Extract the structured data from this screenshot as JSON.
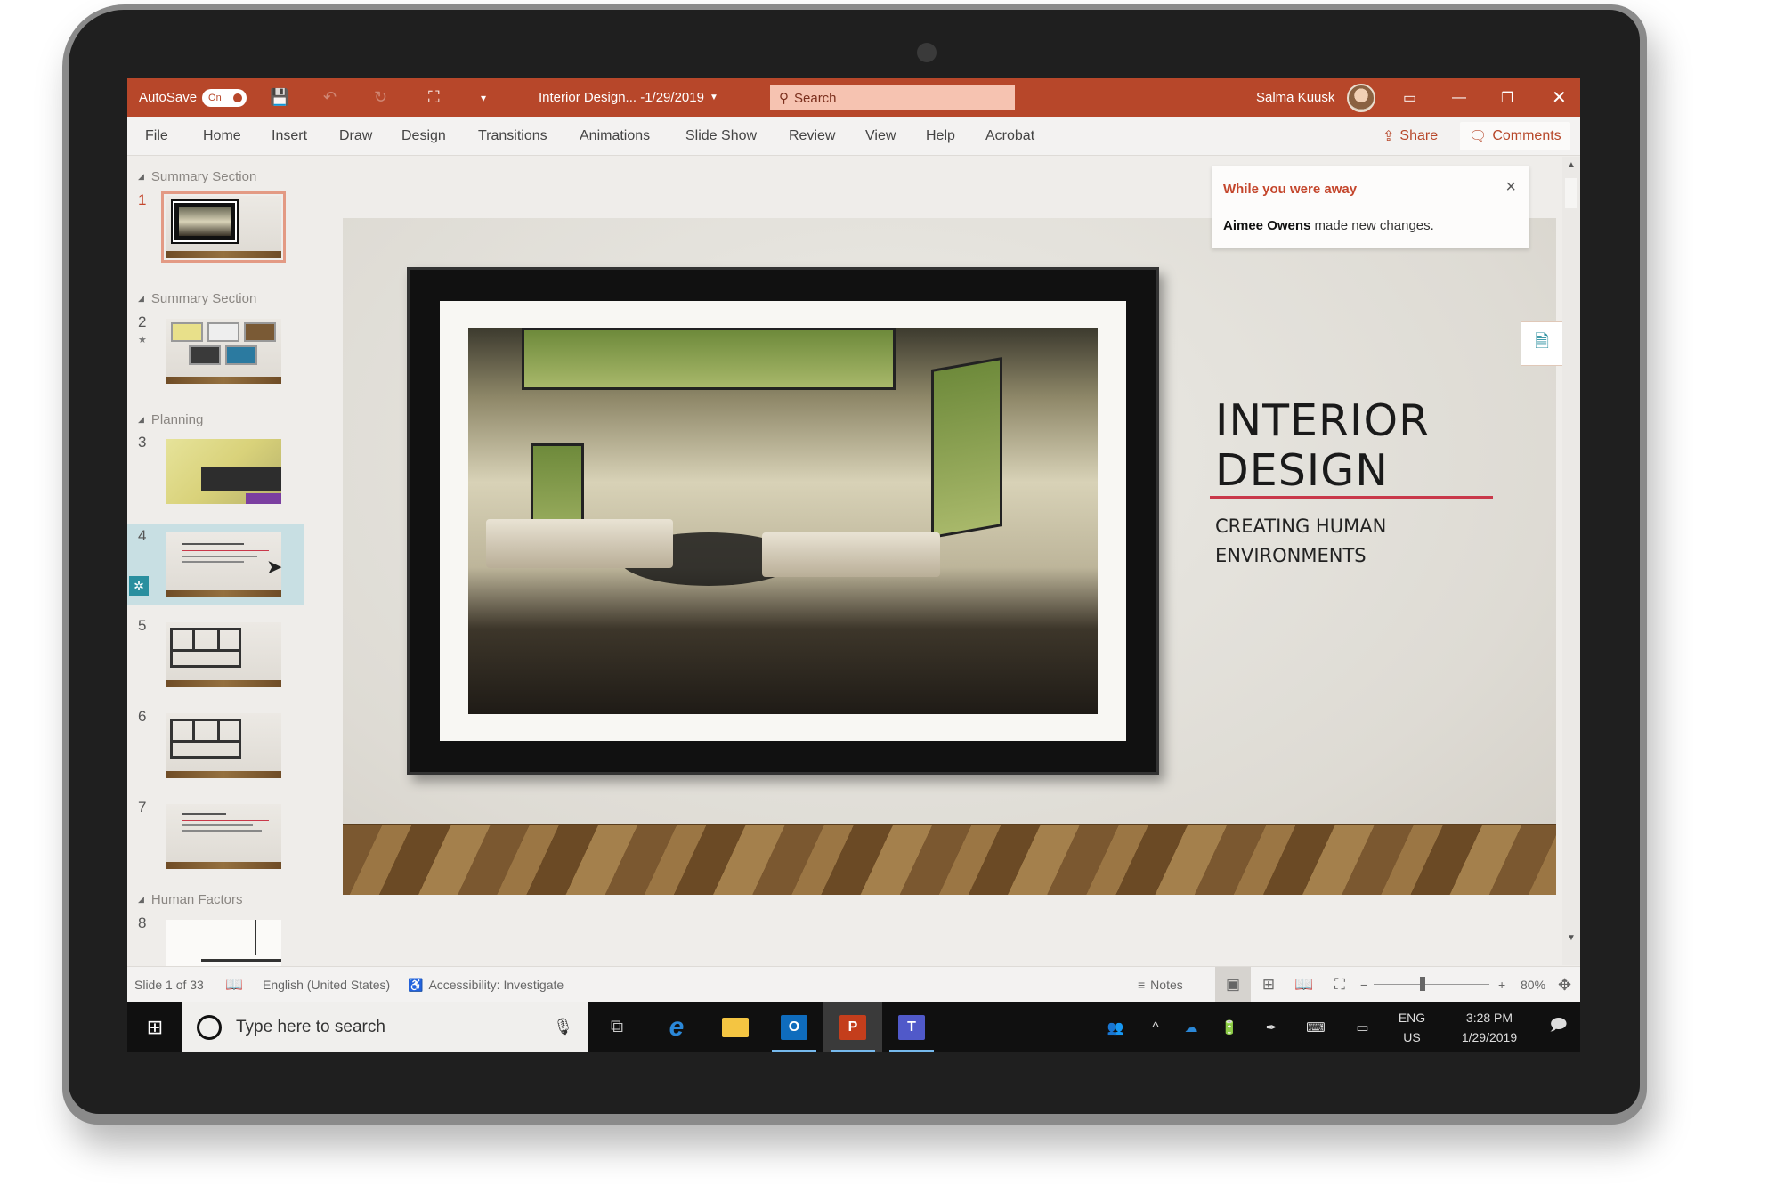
{
  "titlebar": {
    "autosave_label": "AutoSave",
    "autosave_state": "On",
    "doc_title": "Interior Design... -1/29/2019",
    "search_placeholder": "Search",
    "user_name": "Salma Kuusk",
    "icons": [
      "save-icon",
      "undo-icon",
      "redo-icon",
      "start-from-beginning-icon",
      "customize-qat-icon"
    ],
    "window_controls": [
      "ribbon-display-options",
      "minimize",
      "restore",
      "close"
    ]
  },
  "ribbon": {
    "tabs": [
      "File",
      "Home",
      "Insert",
      "Draw",
      "Design",
      "Transitions",
      "Animations",
      "Slide Show",
      "Review",
      "View",
      "Help",
      "Acrobat"
    ],
    "share_label": "Share",
    "comments_label": "Comments"
  },
  "thumbnails": {
    "sections": [
      {
        "label": "Summary Section"
      },
      {
        "label": "Summary Section"
      },
      {
        "label": "Planning"
      },
      {
        "label": "Human Factors"
      }
    ],
    "slides": [
      {
        "number": "1",
        "selected": true
      },
      {
        "number": "2"
      },
      {
        "number": "3"
      },
      {
        "number": "4",
        "hovered": true
      },
      {
        "number": "5"
      },
      {
        "number": "6"
      },
      {
        "number": "7"
      },
      {
        "number": "8"
      }
    ]
  },
  "slide": {
    "title_line1": "INTERIOR",
    "title_line2": "DESIGN",
    "subtitle_line1": "CREATING HUMAN",
    "subtitle_line2": "ENVIRONMENTS",
    "accent_color": "#c9384a"
  },
  "notification": {
    "title": "While you were away",
    "author": "Aimee Owens",
    "message": "made new changes.",
    "close": "×"
  },
  "statusbar": {
    "slide_count": "Slide 1 of 33",
    "language": "English (United States)",
    "accessibility": "Accessibility: Investigate",
    "notes_label": "Notes",
    "zoom_minus": "−",
    "zoom_plus": "+",
    "zoom_level": "80%",
    "zoom_fraction": 0.4
  },
  "taskbar": {
    "search_placeholder": "Type here to search",
    "language_line1": "ENG",
    "language_line2": "US",
    "time": "3:28 PM",
    "date": "1/29/2019",
    "apps": [
      "task-view",
      "edge",
      "file-explorer",
      "outlook",
      "powerpoint",
      "teams"
    ]
  },
  "colors": {
    "brand": "#b7472a",
    "search_bg": "#f6c3b1",
    "notification_title": "#c4462c"
  }
}
